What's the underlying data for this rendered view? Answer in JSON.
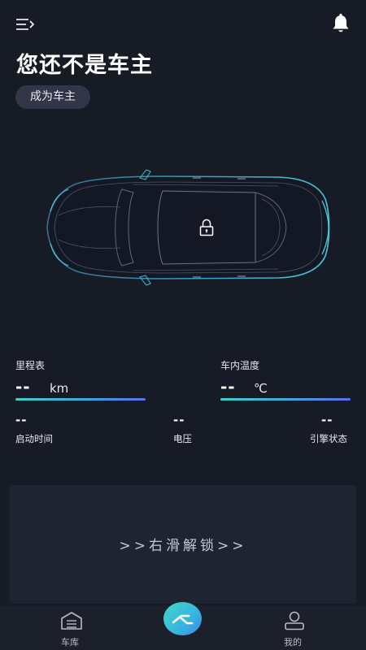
{
  "header": {
    "title": "您还不是车主",
    "owner_button": "成为车主"
  },
  "metrics": {
    "mileage": {
      "label": "里程表",
      "value": "--",
      "unit": "km"
    },
    "cabin_temp": {
      "label": "车内温度",
      "value": "--",
      "unit": "℃"
    },
    "start_time": {
      "label": "启动时间",
      "value": "--"
    },
    "voltage": {
      "label": "电压",
      "value": "--"
    },
    "engine_status": {
      "label": "引擎状态",
      "value": "--"
    }
  },
  "unlock": {
    "text": ">>右滑解锁>>"
  },
  "tabbar": {
    "garage": "车库",
    "mine": "我的"
  },
  "colors": {
    "background": "#171b26",
    "accent_start": "#3fd0c8",
    "accent_end": "#5b6ef0"
  },
  "icons": [
    "menu-icon",
    "bell-icon",
    "lock-icon",
    "garage-icon",
    "brand-logo-icon",
    "user-icon"
  ]
}
